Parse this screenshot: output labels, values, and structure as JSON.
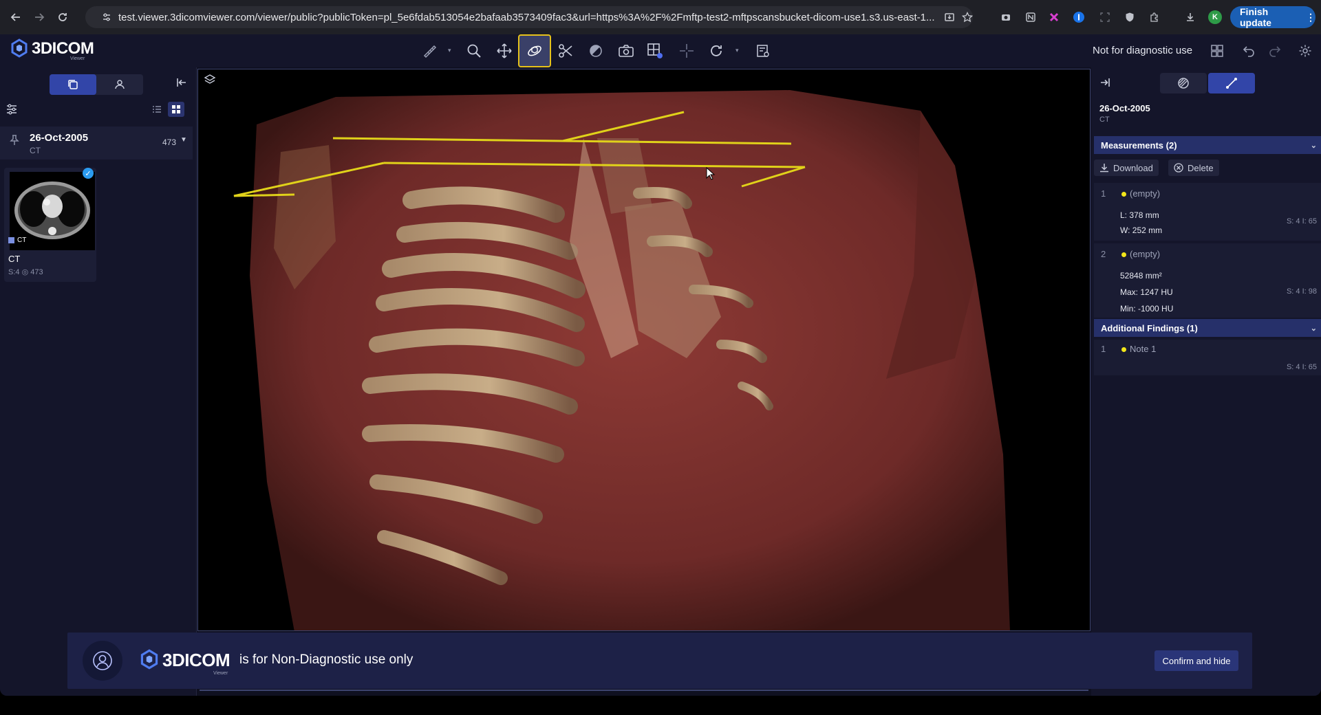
{
  "browser": {
    "url": "test.viewer.3dicomviewer.com/viewer/public?publicToken=pl_5e6fdab513054e2bafaab3573409fac3&url=https%3A%2F%2Fmftp-test2-mftpscansbucket-dicom-use1.s3.us-east-1...",
    "finish_update_label": "Finish update",
    "profile_initial": "K"
  },
  "app": {
    "logo_text": "3DICOM",
    "logo_sub": "Viewer",
    "not_diagnostic": "Not for diagnostic use"
  },
  "left_panel": {
    "study": {
      "date": "26-Oct-2005",
      "modality": "CT",
      "count": "473"
    },
    "series": {
      "thumb_label": "CT",
      "name": "CT",
      "meta": "S:4  ◎ 473"
    }
  },
  "right_panel": {
    "date": "26-Oct-2005",
    "modality": "CT",
    "measurements_header": "Measurements (2)",
    "download_label": "Download",
    "delete_label": "Delete",
    "measurements": [
      {
        "index": "1",
        "name": "(empty)",
        "values": [
          "L: 378 mm",
          "W: 252 mm"
        ],
        "slice": "S: 4 I: 65"
      },
      {
        "index": "2",
        "name": "(empty)",
        "values": [
          "52848 mm²",
          "Max: 1247 HU",
          "Min: -1000 HU"
        ],
        "slice": "S: 4 I: 98"
      }
    ],
    "findings_header": "Additional Findings (1)",
    "findings": [
      {
        "index": "1",
        "name": "Note 1",
        "slice": "S: 4 I: 65"
      }
    ]
  },
  "banner": {
    "logo_text": "3DICOM",
    "logo_sub": "Viewer",
    "text": "is for Non-Diagnostic use only",
    "confirm_label": "Confirm and hide"
  },
  "colors": {
    "accent": "#3245a8",
    "highlight": "#e6c21a",
    "measurement": "#f2e61a",
    "panel": "#14152a"
  }
}
